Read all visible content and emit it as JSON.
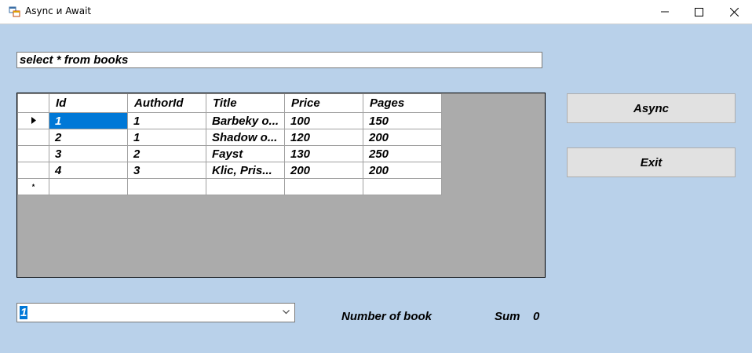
{
  "window": {
    "title": "Async и Await"
  },
  "query": {
    "value": "select * from books"
  },
  "grid": {
    "columns": [
      "Id",
      "AuthorId",
      "Title",
      "Price",
      "Pages"
    ],
    "rows": [
      [
        "1",
        "1",
        "Barbeky o...",
        "100",
        "150"
      ],
      [
        "2",
        "1",
        "Shadow o...",
        "120",
        "200"
      ],
      [
        "3",
        "2",
        "Fayst",
        "130",
        "250"
      ],
      [
        "4",
        "3",
        "Klic, Pris...",
        "200",
        "200"
      ]
    ],
    "new_row_marker": "*"
  },
  "buttons": {
    "async_label": "Async",
    "exit_label": "Exit"
  },
  "combo": {
    "selected": "1"
  },
  "labels": {
    "number_of_book": "Number of book",
    "sum_label": "Sum",
    "sum_value": "0"
  }
}
